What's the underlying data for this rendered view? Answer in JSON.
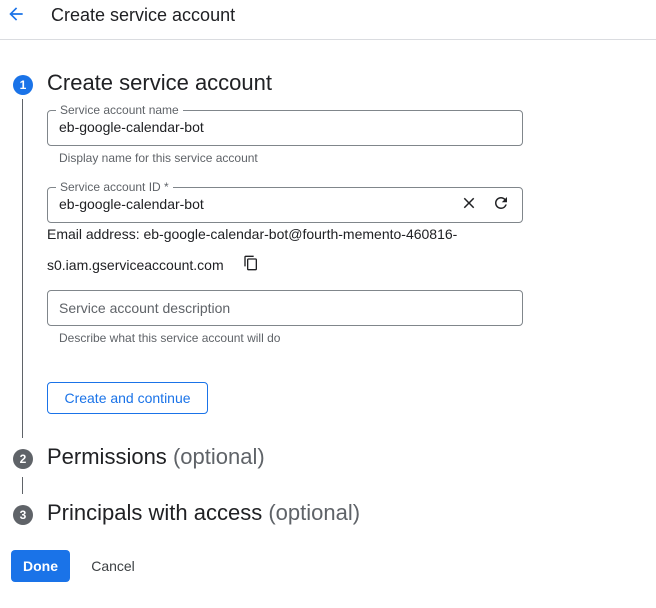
{
  "header": {
    "title": "Create service account",
    "back_icon": "arrow-back-icon"
  },
  "steps": [
    {
      "number": "1",
      "title": "Create service account",
      "optional": ""
    },
    {
      "number": "2",
      "title": "Permissions",
      "optional": "(optional)"
    },
    {
      "number": "3",
      "title": "Principals with access",
      "optional": "(optional)"
    }
  ],
  "form": {
    "name_field": {
      "label": "Service account name",
      "value": "eb-google-calendar-bot",
      "hint": "Display name for this service account"
    },
    "id_field": {
      "label": "Service account ID *",
      "value": "eb-google-calendar-bot",
      "clear_icon": "close-icon",
      "refresh_icon": "refresh-icon"
    },
    "email": {
      "line1": "Email address: eb-google-calendar-bot@fourth-memento-460816-",
      "line2": "s0.iam.gserviceaccount.com",
      "copy_icon": "copy-icon"
    },
    "description_field": {
      "placeholder": "Service account description",
      "hint": "Describe what this service account will do"
    },
    "create_button": "Create and continue"
  },
  "footer": {
    "done": "Done",
    "cancel": "Cancel"
  },
  "colors": {
    "accent": "#1a73e8",
    "text": "#202124",
    "secondary_text": "#5f6368",
    "border": "#80868b"
  }
}
